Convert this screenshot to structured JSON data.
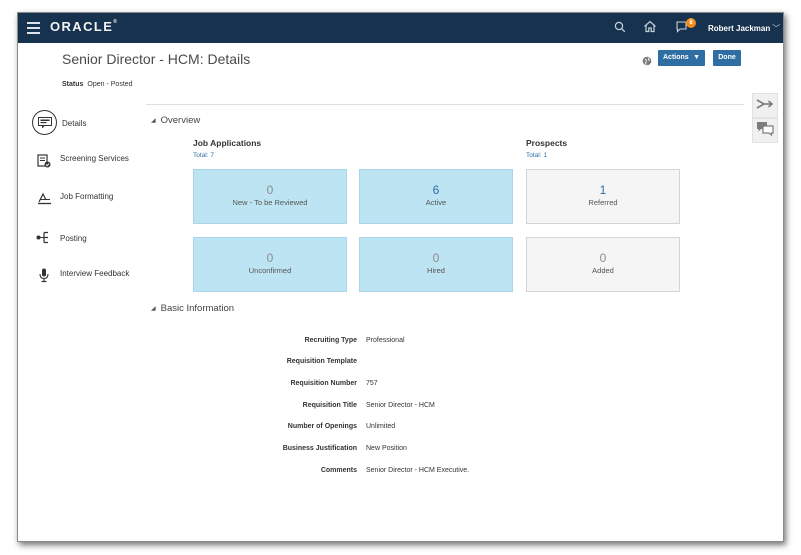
{
  "header": {
    "brand": "ORACLE",
    "user_name": "Robert Jackman",
    "notification_count": "6",
    "icons": [
      "menu-icon",
      "search-icon",
      "home-icon",
      "notification-icon"
    ]
  },
  "page": {
    "title": "Senior Director - HCM: Details",
    "status_label": "Status",
    "status_value": "Open - Posted",
    "actions_label": "Actions",
    "done_label": "Done"
  },
  "nav": {
    "items": [
      {
        "label": "Details",
        "icon": "details-icon"
      },
      {
        "label": "Screening Services",
        "icon": "screening-icon"
      },
      {
        "label": "Job Formatting",
        "icon": "job-formatting-icon"
      },
      {
        "label": "Posting",
        "icon": "posting-icon"
      },
      {
        "label": "Interview Feedback",
        "icon": "interview-feedback-icon"
      }
    ]
  },
  "overview": {
    "heading": "Overview",
    "job_applications": {
      "title": "Job Applications",
      "total": "Total: 7",
      "tiles": [
        {
          "count": "0",
          "label": "New - To be Reviewed"
        },
        {
          "count": "6",
          "label": "Active"
        },
        {
          "count": "0",
          "label": "Unconfirmed"
        },
        {
          "count": "0",
          "label": "Hired"
        }
      ]
    },
    "prospects": {
      "title": "Prospects",
      "total": "Total: 1",
      "tiles": [
        {
          "count": "1",
          "label": "Referred"
        },
        {
          "count": "0",
          "label": "Added"
        }
      ]
    }
  },
  "basic_info": {
    "heading": "Basic Information",
    "rows": [
      {
        "label": "Recruiting Type",
        "value": "Professional"
      },
      {
        "label": "Requisition Template",
        "value": ""
      },
      {
        "label": "Requisition Number",
        "value": "757"
      },
      {
        "label": "Requisition Title",
        "value": "Senior Director - HCM"
      },
      {
        "label": "Number of Openings",
        "value": "Unlimited"
      },
      {
        "label": "Business Justification",
        "value": "New Position"
      },
      {
        "label": "Comments",
        "value": "Senior Director - HCM Executive."
      }
    ]
  },
  "colors": {
    "header_bg": "#17324f",
    "accent": "#2f6ea3",
    "tile_blue": "#bde4f2",
    "tile_gray": "#f5f5f5",
    "badge": "#f28c1b"
  }
}
